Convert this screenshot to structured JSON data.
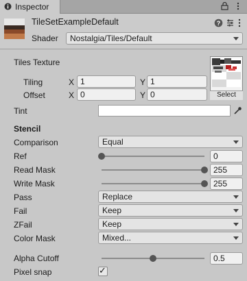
{
  "tab": {
    "title": "Inspector",
    "icon": "info-icon"
  },
  "window_icons": [
    "lock-icon",
    "menu-icon"
  ],
  "material": {
    "name": "TileSetExampleDefault",
    "shader_label": "Shader",
    "shader_value": "Nostalgia/Tiles/Default",
    "header_icons": [
      "help-icon",
      "preset-icon",
      "kebab-icon"
    ]
  },
  "texture": {
    "label": "Tiles Texture",
    "tiling_label": "Tiling",
    "offset_label": "Offset",
    "tiling_x": "1",
    "tiling_y": "1",
    "offset_x": "0",
    "offset_y": "0",
    "x_label": "X",
    "y_label": "Y",
    "select_label": "Select"
  },
  "tint": {
    "label": "Tint",
    "icon": "eyedropper-icon"
  },
  "stencil": {
    "header": "Stencil",
    "comparison_label": "Comparison",
    "comparison_value": "Equal",
    "ref_label": "Ref",
    "ref_value": "0",
    "ref_fraction": 0.0,
    "read_mask_label": "Read Mask",
    "read_mask_value": "255",
    "read_mask_fraction": 1.0,
    "write_mask_label": "Write Mask",
    "write_mask_value": "255",
    "write_mask_fraction": 1.0,
    "pass_label": "Pass",
    "pass_value": "Replace",
    "fail_label": "Fail",
    "fail_value": "Keep",
    "zfail_label": "ZFail",
    "zfail_value": "Keep",
    "color_mask_label": "Color Mask",
    "color_mask_value": "Mixed..."
  },
  "alpha": {
    "cutoff_label": "Alpha Cutoff",
    "cutoff_value": "0.5",
    "cutoff_fraction": 0.5,
    "pixel_snap_label": "Pixel snap",
    "pixel_snap_checked": true,
    "check_glyph": "✓"
  }
}
